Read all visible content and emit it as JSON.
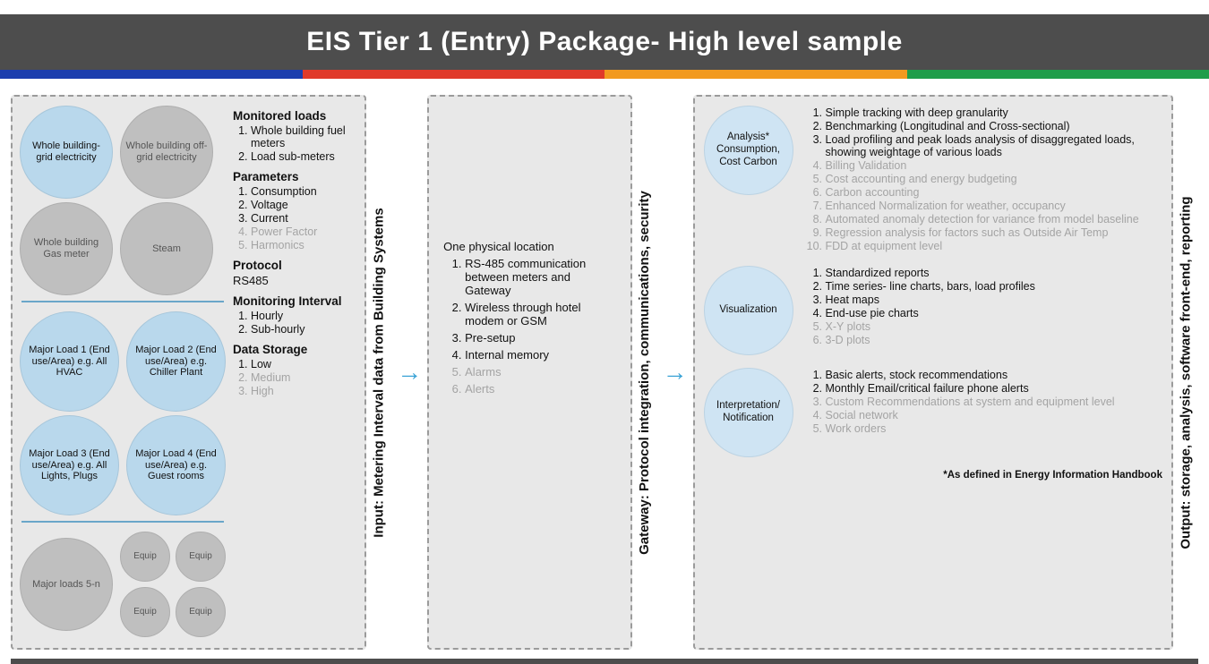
{
  "title": "EIS Tier 1 (Entry) Package- High level sample",
  "input": {
    "vlabel": "Input: Metering Interval data from Building Systems",
    "bubbles": {
      "top": [
        {
          "label": "Whole building- grid electricity",
          "color": "blue",
          "size": "c104"
        },
        {
          "label": "Whole building off-grid electricity",
          "color": "grey",
          "size": "c104"
        }
      ],
      "top2": [
        {
          "label": "Whole building Gas meter",
          "color": "grey",
          "size": "c104"
        },
        {
          "label": "Steam",
          "color": "grey",
          "size": "c104"
        }
      ],
      "loads": [
        {
          "label": "Major Load 1 (End use/Area) e.g. All HVAC",
          "color": "blue",
          "size": "c110"
        },
        {
          "label": "Major Load 2 (End use/Area) e.g. Chiller Plant",
          "color": "blue",
          "size": "c110"
        },
        {
          "label": "Major Load 3 (End use/Area) e.g. All Lights, Plugs",
          "color": "blue",
          "size": "c110"
        },
        {
          "label": "Major Load 4 (End use/Area) e.g. Guest rooms",
          "color": "blue",
          "size": "c110"
        }
      ],
      "equip": {
        "big": {
          "label": "Major loads 5-n",
          "color": "grey",
          "size": "c104"
        },
        "small_label": "Equip"
      }
    },
    "spec": {
      "monitored_heading": "Monitored loads",
      "monitored": [
        "Whole building fuel meters",
        "Load sub-meters"
      ],
      "parameters_heading": "Parameters",
      "parameters": [
        {
          "t": "Consumption",
          "muted": false
        },
        {
          "t": "Voltage",
          "muted": false
        },
        {
          "t": "Current",
          "muted": false
        },
        {
          "t": "Power Factor",
          "muted": true
        },
        {
          "t": "Harmonics",
          "muted": true
        }
      ],
      "protocol_heading": "Protocol",
      "protocol_value": "RS485",
      "interval_heading": "Monitoring Interval",
      "interval": [
        "Hourly",
        "Sub-hourly"
      ],
      "storage_heading": "Data Storage",
      "storage": [
        {
          "t": "Low",
          "muted": false
        },
        {
          "t": "Medium",
          "muted": true
        },
        {
          "t": "High",
          "muted": true
        }
      ]
    }
  },
  "gateway": {
    "vlabel": "Gateway: Protocol integration, communications, security",
    "lead": "One physical location",
    "items": [
      {
        "t": "RS-485 communication between meters and Gateway",
        "muted": false
      },
      {
        "t": "Wireless through hotel modem or GSM",
        "muted": false
      },
      {
        "t": "Pre-setup",
        "muted": false
      },
      {
        "t": "Internal memory",
        "muted": false
      },
      {
        "t": "Alarms",
        "muted": true
      },
      {
        "t": "Alerts",
        "muted": true
      }
    ]
  },
  "output": {
    "vlabel": "Output: storage, analysis, software front-end, reporting",
    "rows": [
      {
        "circle": "Analysis* Consumption, Cost Carbon",
        "items": [
          {
            "t": "Simple tracking with deep granularity",
            "muted": false
          },
          {
            "t": "Benchmarking (Longitudinal and Cross-sectional)",
            "muted": false
          },
          {
            "t": "Load profiling and peak loads analysis of disaggregated loads, showing weightage of various loads",
            "muted": false
          },
          {
            "t": "Billing Validation",
            "muted": true
          },
          {
            "t": "Cost accounting and energy budgeting",
            "muted": true
          },
          {
            "t": "Carbon accounting",
            "muted": true
          },
          {
            "t": "Enhanced Normalization for weather, occupancy",
            "muted": true
          },
          {
            "t": "Automated anomaly detection for variance from model baseline",
            "muted": true
          },
          {
            "t": "Regression analysis for factors such as Outside Air Temp",
            "muted": true
          },
          {
            "t": "FDD at equipment level",
            "muted": true
          }
        ]
      },
      {
        "circle": "Visualization",
        "items": [
          {
            "t": "Standardized reports",
            "muted": false
          },
          {
            "t": "Time series- line charts, bars, load profiles",
            "muted": false
          },
          {
            "t": "Heat maps",
            "muted": false
          },
          {
            "t": "End-use pie charts",
            "muted": false
          },
          {
            "t": "X-Y plots",
            "muted": true
          },
          {
            "t": "3-D plots",
            "muted": true
          }
        ]
      },
      {
        "circle": "Interpretation/ Notification",
        "items": [
          {
            "t": "Basic alerts, stock recommendations",
            "muted": false
          },
          {
            "t": "Monthly Email/critical failure phone alerts",
            "muted": false
          },
          {
            "t": "Custom Recommendations at system and equipment level",
            "muted": true
          },
          {
            "t": "Social network",
            "muted": true
          },
          {
            "t": "Work orders",
            "muted": true
          }
        ]
      }
    ],
    "footnote": "*As defined in Energy Information Handbook"
  }
}
